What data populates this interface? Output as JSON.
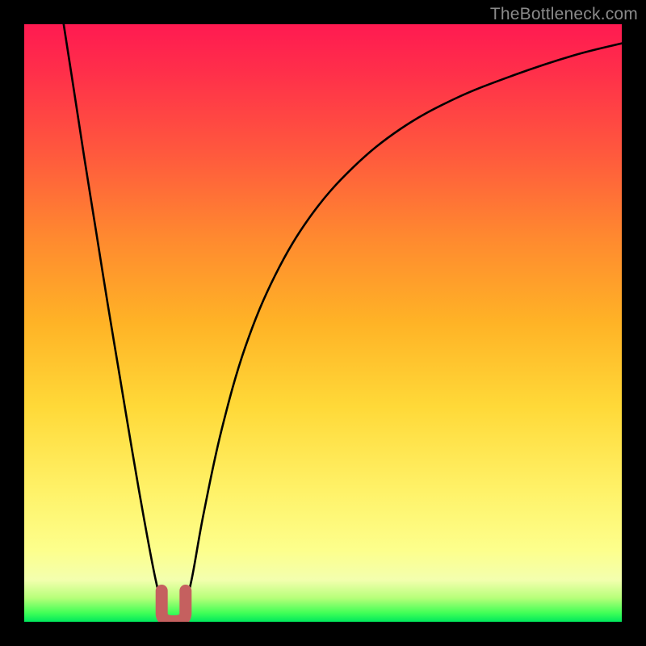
{
  "watermark": "TheBottleneck.com",
  "chart_data": {
    "type": "line",
    "title": "",
    "xlabel": "",
    "ylabel": "",
    "xlim": [
      0,
      100
    ],
    "ylim": [
      0,
      100
    ],
    "grid": false,
    "legend": false,
    "series": [
      {
        "name": "bottleneck-curve",
        "x": [
          6.6,
          8,
          10,
          12,
          14,
          16,
          18,
          20,
          22,
          23.5,
          25,
          26.5,
          28,
          30,
          33,
          37,
          42,
          48,
          55,
          63,
          72,
          82,
          92,
          100
        ],
        "y": [
          100,
          91,
          78,
          65.5,
          53,
          41,
          29,
          17.5,
          7,
          1.5,
          0.3,
          1.5,
          7,
          18,
          32,
          46,
          58,
          68,
          76,
          82.5,
          87.5,
          91.5,
          94.8,
          96.8
        ]
      }
    ],
    "annotations": [
      {
        "name": "valley-marker",
        "shape": "u-stub",
        "color": "#c5605f",
        "x_center": 25,
        "x_half_width": 2.0,
        "y_top": 5.2,
        "y_bottom": 0.6
      }
    ],
    "background": {
      "type": "vertical-gradient",
      "stops": [
        {
          "pos": 0.0,
          "color": "#ff1a51"
        },
        {
          "pos": 0.5,
          "color": "#ffb326"
        },
        {
          "pos": 0.88,
          "color": "#fdff8c"
        },
        {
          "pos": 1.0,
          "color": "#00e85c"
        }
      ]
    }
  }
}
